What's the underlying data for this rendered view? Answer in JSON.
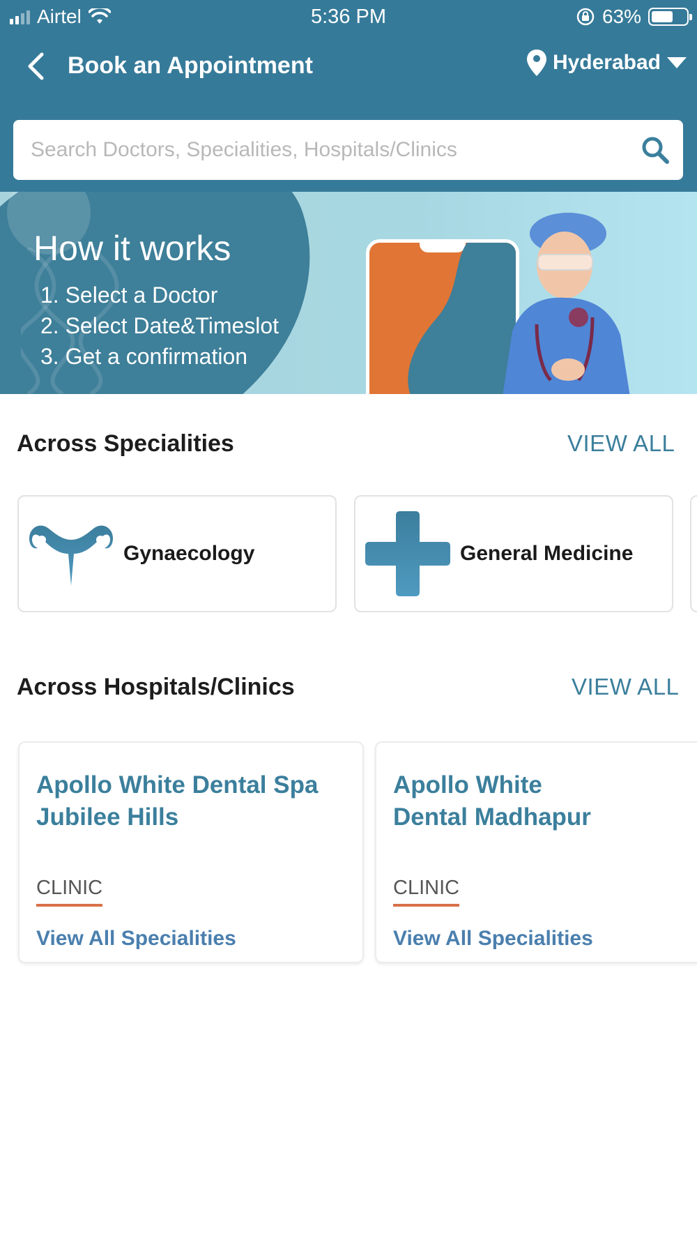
{
  "status_bar": {
    "carrier": "Airtel",
    "time": "5:36 PM",
    "battery": "63%"
  },
  "header": {
    "title": "Book an Appointment",
    "location": "Hyderabad"
  },
  "search": {
    "placeholder": "Search Doctors, Specialities, Hospitals/Clinics"
  },
  "banner": {
    "title": "How it works",
    "steps": [
      "1. Select a Doctor",
      "2. Select Date&Timeslot",
      "3. Get a confirmation"
    ]
  },
  "specialities": {
    "title": "Across Specialities",
    "view_all": "VIEW ALL",
    "items": [
      {
        "label": "Gynaecology",
        "icon": "uterus-icon"
      },
      {
        "label": "General Medicine",
        "icon": "medical-cross-icon"
      }
    ]
  },
  "hospitals": {
    "title": "Across Hospitals/Clinics",
    "view_all": "VIEW ALL",
    "items": [
      {
        "name_line1": "Apollo White Dental Spa",
        "name_line2": "Jubilee Hills",
        "type": "CLINIC",
        "link": "View All Specialities"
      },
      {
        "name_line1": "Apollo White",
        "name_line2": "Dental Madhapur",
        "type": "CLINIC",
        "link": "View All Specialities"
      }
    ]
  },
  "colors": {
    "header_bg": "#367a99",
    "accent": "#3b7f9c",
    "clinic_underline": "#d8714a"
  }
}
